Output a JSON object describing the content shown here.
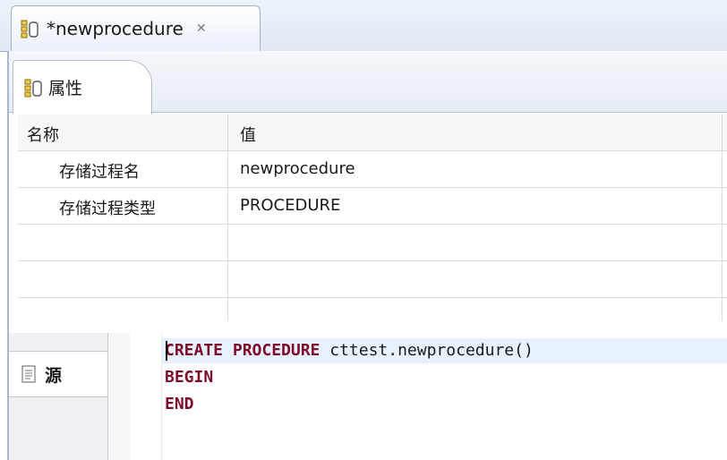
{
  "editor_tab": {
    "title": "*newprocedure"
  },
  "inner_tab": {
    "label": "属性"
  },
  "properties": {
    "columns": {
      "name": "名称",
      "value": "值"
    },
    "rows": [
      {
        "name": "存储过程名",
        "value": "newprocedure"
      },
      {
        "name": "存储过程类型",
        "value": "PROCEDURE"
      }
    ]
  },
  "source_tab": {
    "label": "源"
  },
  "code": {
    "line1_keyword": "CREATE PROCEDURE",
    "line1_rest": " cttest.newprocedure()",
    "line2": "BEGIN",
    "line3": "END"
  },
  "colors": {
    "keyword": "#7f0b2a",
    "current_line": "#e8f2fe"
  }
}
